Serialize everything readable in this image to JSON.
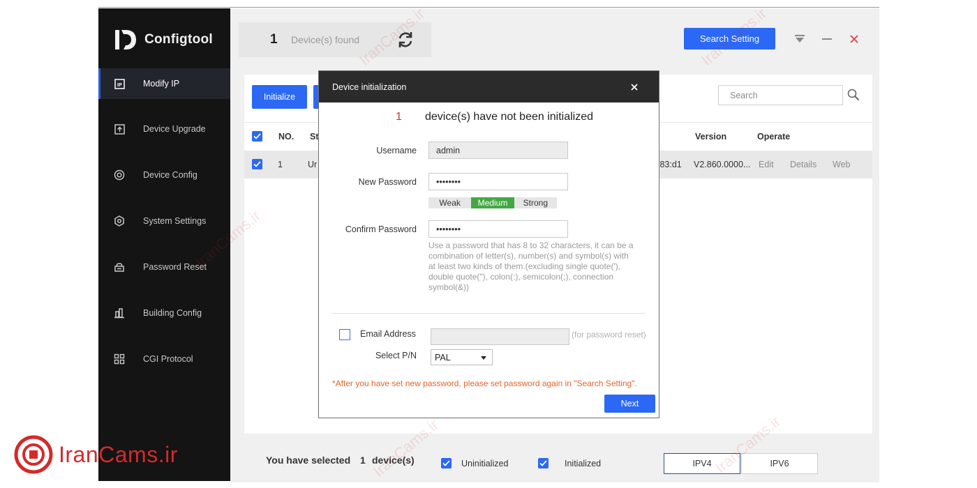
{
  "app": {
    "title": "Configtool",
    "found_count": "1",
    "found_label": "Device(s) found",
    "search_setting_label": "Search Setting"
  },
  "sidebar": {
    "items": [
      {
        "label": "Modify IP",
        "icon": "ip-icon"
      },
      {
        "label": "Device Upgrade",
        "icon": "upgrade-icon"
      },
      {
        "label": "Device Config",
        "icon": "device-config-icon"
      },
      {
        "label": "System Settings",
        "icon": "system-settings-icon"
      },
      {
        "label": "Password Reset",
        "icon": "password-reset-icon"
      },
      {
        "label": "Building Config",
        "icon": "building-icon"
      },
      {
        "label": "CGI Protocol",
        "icon": "cgi-icon"
      }
    ]
  },
  "toolbar": {
    "initialize_label": "Initialize",
    "search_placeholder": "Search"
  },
  "table": {
    "headers": {
      "no": "NO.",
      "status": "St",
      "version": "Version",
      "operate": "Operate"
    },
    "rows": [
      {
        "no": "1",
        "status": "Ur",
        "mac_tail": ":83:d1",
        "version": "V2.860.0000...",
        "edit": "Edit",
        "details": "Details",
        "web": "Web"
      }
    ]
  },
  "footer": {
    "selected_prefix": "You have selected",
    "selected_count": "1",
    "selected_suffix": "device(s)",
    "uninitialized_label": "Uninitialized",
    "initialized_label": "Initialized",
    "ipv4_label": "IPV4",
    "ipv6_label": "IPV6"
  },
  "dialog": {
    "title": "Device initialization",
    "count": "1",
    "message": "device(s) have not been initialized",
    "username_label": "Username",
    "username_value": "admin",
    "new_password_label": "New Password",
    "new_password_value": "••••••••",
    "strength": {
      "weak": "Weak",
      "medium": "Medium",
      "strong": "Strong"
    },
    "confirm_password_label": "Confirm Password",
    "confirm_password_value": "••••••••",
    "hint": "Use a password that has 8 to 32 characters, it can be a combination of letter(s), number(s) and symbol(s) with at least two kinds of them.(excluding single quote('), double quote(\"), colon(:), semicolon(;), connection symbol(&))",
    "email_label": "Email Address",
    "email_hint": "(for password reset)",
    "pn_label": "Select P/N",
    "pn_value": "PAL",
    "warning": "*After you have set new password, please set password again in \"Search Setting\".",
    "next_label": "Next"
  },
  "brand": {
    "text": "IranCams.ir"
  },
  "watermark": {
    "text": "IranCams.ir"
  },
  "colors": {
    "accent": "#2b68f5",
    "sidebar": "#141414",
    "close": "#e05050",
    "strength_medium": "#43a843",
    "warning": "#e8632a",
    "brand": "#d42a2a"
  }
}
